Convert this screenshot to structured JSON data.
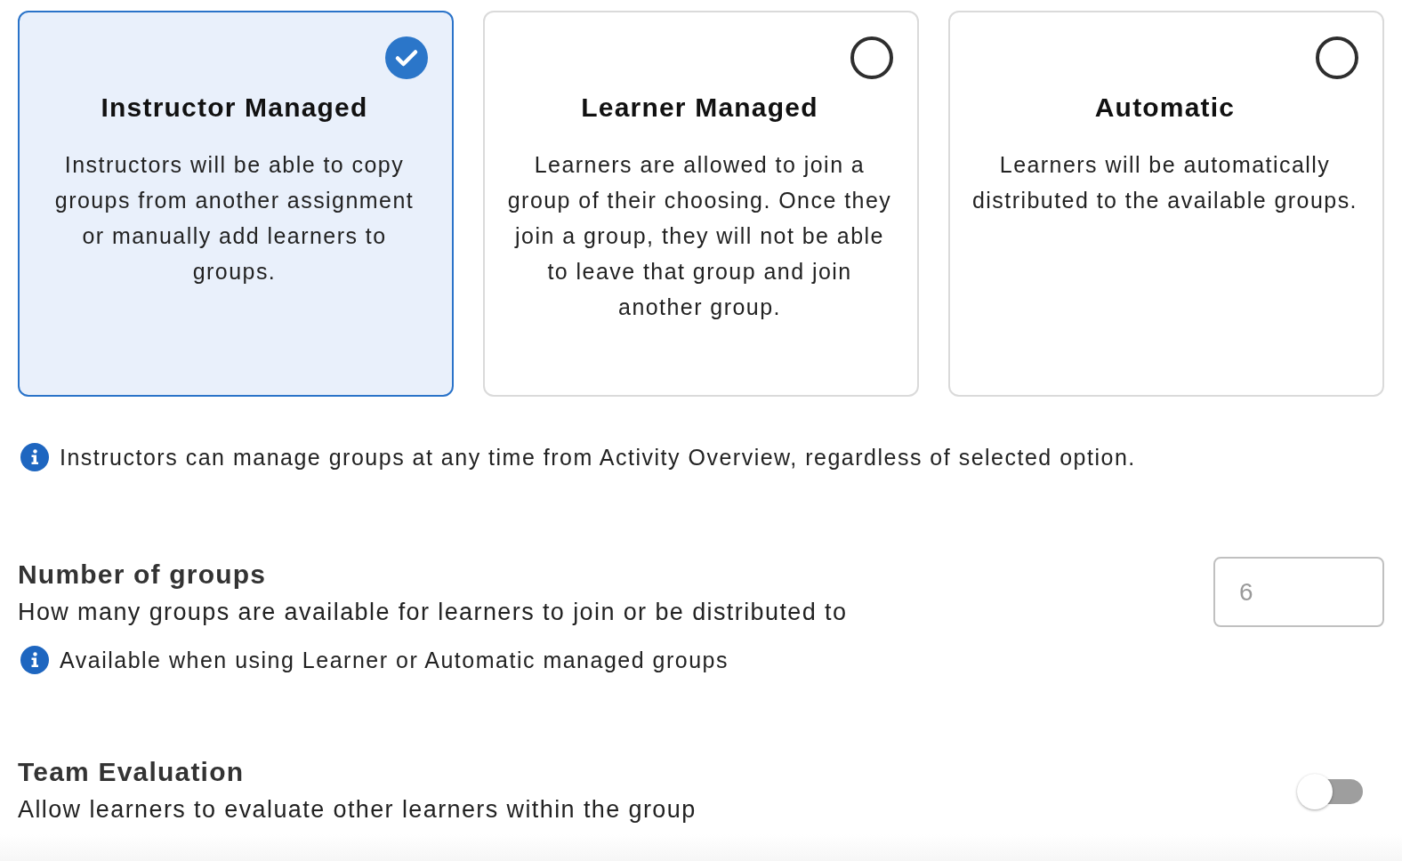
{
  "options": [
    {
      "title": "Instructor Managed",
      "description": "Instructors will be able to copy groups from another assignment or manually add learners to groups.",
      "selected": true
    },
    {
      "title": "Learner Managed",
      "description": "Learners are allowed to join a group of their choosing. Once they join a group, they will not be able to leave that group and join another group.",
      "selected": false
    },
    {
      "title": "Automatic",
      "description": "Learners will be automatically distributed to the available groups.",
      "selected": false
    }
  ],
  "notice": {
    "text": "Instructors can manage groups at any time from Activity Overview, regardless of selected option."
  },
  "settings": [
    {
      "kind": "number",
      "title": "Number of groups",
      "description": "How many groups are available for learners to join or be distributed to",
      "value": "6",
      "disabled": true,
      "note": "Available when using Learner or Automatic managed groups"
    },
    {
      "kind": "toggle",
      "title": "Team Evaluation",
      "description": "Allow learners to evaluate other learners within the group",
      "on": false
    }
  ]
}
